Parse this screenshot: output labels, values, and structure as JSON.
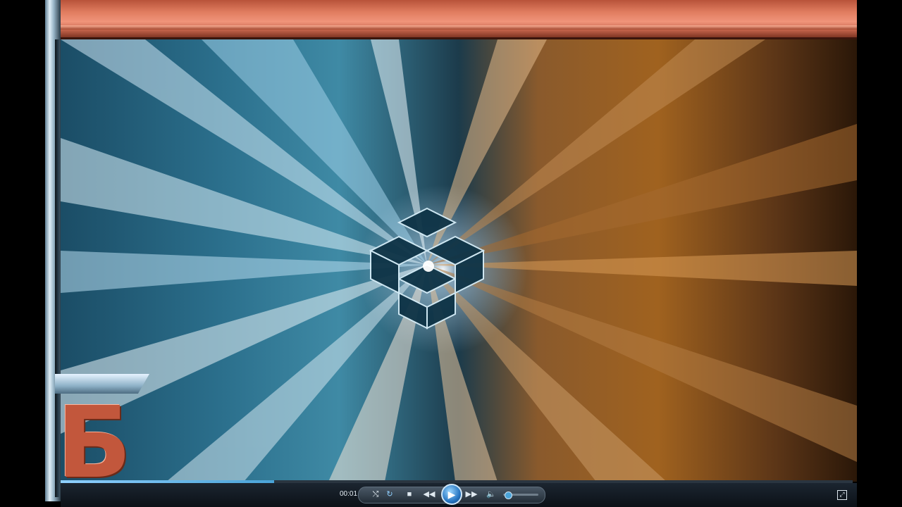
{
  "player": {
    "time": "00:01",
    "progress": 0.27,
    "volume": 0.12,
    "icons": {
      "shuffle": "shuffle-icon",
      "repeat": "repeat-icon",
      "stop": "stop-icon",
      "previous": "rewind-icon",
      "play": "play-icon",
      "next": "fast-forward-icon",
      "volume": "speaker-icon",
      "fullscreen": "fullscreen-icon"
    },
    "glyphs": {
      "shuffle": "⤭",
      "repeat": "↻",
      "stop": "■",
      "previous": "◀◀",
      "play": "▶",
      "next": "▶▶",
      "volume": "🔈",
      "fullscreen": "⤢"
    }
  },
  "logo": {
    "letter": "Б"
  },
  "colors": {
    "accent": "#4aa3d8",
    "frame": "#e07c5f"
  }
}
